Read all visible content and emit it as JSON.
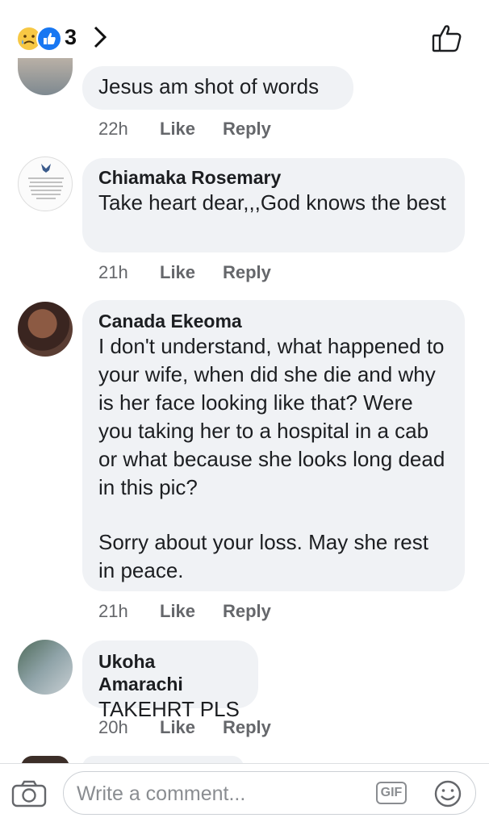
{
  "header": {
    "reaction_count": "3",
    "icons": [
      "sad-reaction-icon",
      "like-reaction-icon",
      "chevron-right-icon",
      "thumbs-up-icon"
    ]
  },
  "comments": [
    {
      "name": "",
      "text": "Jesus am shot of words",
      "time": "22h",
      "like": "Like",
      "reply": "Reply"
    },
    {
      "name": "Chiamaka Rosemary",
      "text": "Take heart dear,,,God knows the best",
      "time": "21h",
      "like": "Like",
      "reply": "Reply"
    },
    {
      "name": "Canada Ekeoma",
      "text": "I don't understand, what happened to your wife, when did she die and why is her face looking like that? Were you taking her to a hospital in a cab or what because she looks long dead in this pic?",
      "text2": "Sorry about your loss. May she rest in peace.",
      "time": "21h",
      "like": "Like",
      "reply": "Reply"
    },
    {
      "name": "Ukoha Amarachi",
      "text": "TAKEHRT PLS",
      "time": "20h",
      "like": "Like",
      "reply": "Reply"
    }
  ],
  "composer": {
    "placeholder": "Write a comment...",
    "gif_label": "GIF",
    "icons": [
      "camera-icon",
      "gif-icon",
      "emoji-icon"
    ]
  },
  "colors": {
    "bubble": "#f0f2f5",
    "meta_text": "#65676b",
    "like_blue": "#1877f2"
  }
}
